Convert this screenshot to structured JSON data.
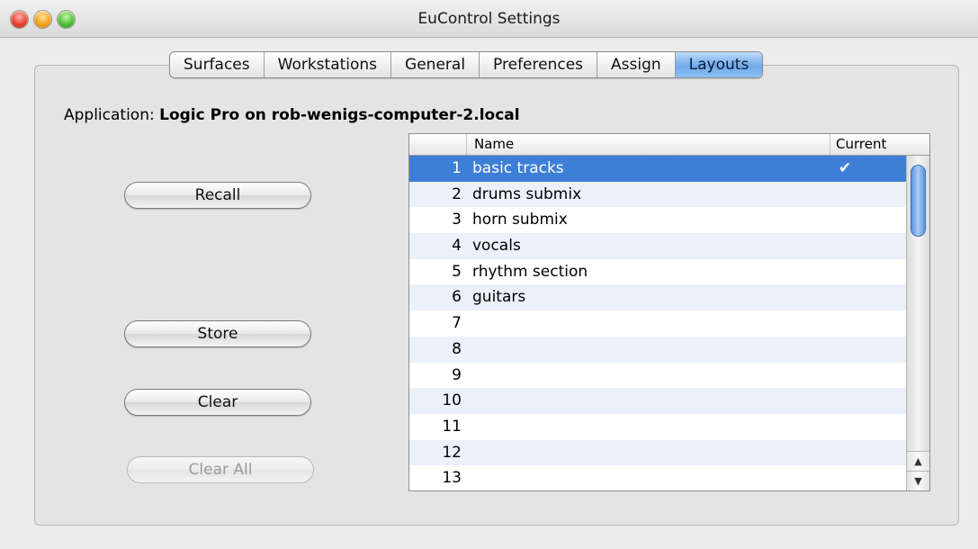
{
  "window": {
    "title": "EuControl Settings"
  },
  "tabs": [
    {
      "label": "Surfaces",
      "active": false
    },
    {
      "label": "Workstations",
      "active": false
    },
    {
      "label": "General",
      "active": false
    },
    {
      "label": "Preferences",
      "active": false
    },
    {
      "label": "Assign",
      "active": false
    },
    {
      "label": "Layouts",
      "active": true
    }
  ],
  "application": {
    "label": "Application:",
    "value": "Logic Pro on rob-wenigs-computer-2.local"
  },
  "buttons": {
    "recall": "Recall",
    "store": "Store",
    "clear": "Clear",
    "clear_all": "Clear All"
  },
  "table": {
    "columns": [
      "",
      "Name",
      "Current"
    ],
    "rows": [
      {
        "num": "1",
        "name": "basic tracks",
        "current": "✔",
        "selected": true
      },
      {
        "num": "2",
        "name": "drums submix",
        "current": ""
      },
      {
        "num": "3",
        "name": "horn submix",
        "current": ""
      },
      {
        "num": "4",
        "name": "vocals",
        "current": ""
      },
      {
        "num": "5",
        "name": "rhythm section",
        "current": ""
      },
      {
        "num": "6",
        "name": "guitars",
        "current": ""
      },
      {
        "num": "7",
        "name": "",
        "current": ""
      },
      {
        "num": "8",
        "name": "",
        "current": ""
      },
      {
        "num": "9",
        "name": "",
        "current": ""
      },
      {
        "num": "10",
        "name": "",
        "current": ""
      },
      {
        "num": "11",
        "name": "",
        "current": ""
      },
      {
        "num": "12",
        "name": "",
        "current": ""
      },
      {
        "num": "13",
        "name": "",
        "current": ""
      }
    ]
  },
  "scrollbar": {
    "up_icon": "▲",
    "down_icon": "▼"
  },
  "colors": {
    "selection": "#3d7fd6",
    "active_tab": "#6fa9ea",
    "row_alt": "#eaf1fb"
  }
}
